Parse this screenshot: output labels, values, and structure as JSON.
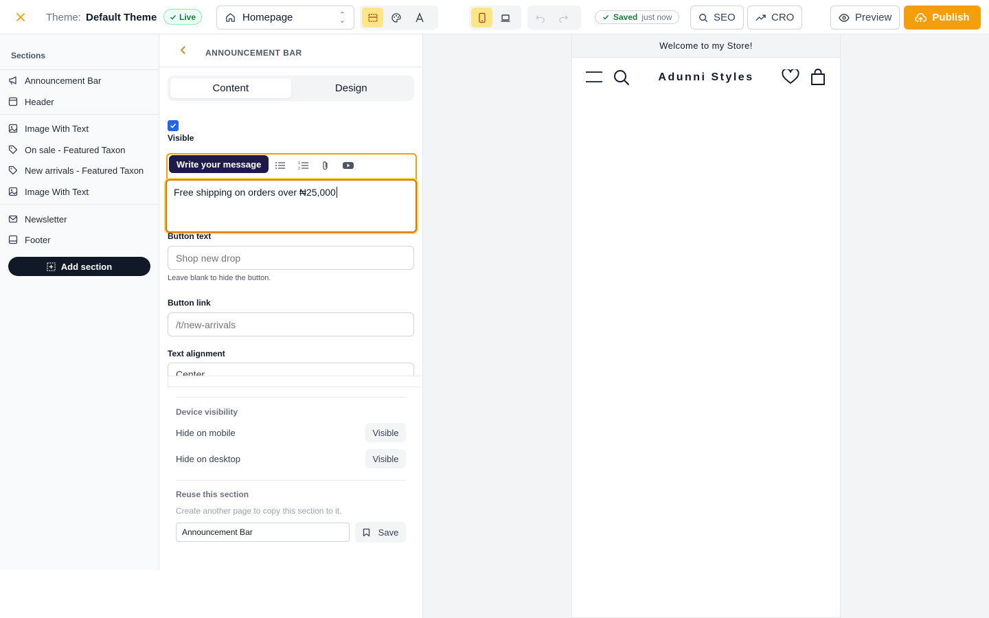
{
  "topbar": {
    "theme_label": "Theme:",
    "theme_name": "Default Theme",
    "live_badge": "Live",
    "page_select": "Homepage",
    "saved_label": "Saved",
    "saved_time": "just now",
    "seo_label": "SEO",
    "cro_label": "CRO",
    "preview_label": "Preview",
    "publish_label": "Publish"
  },
  "sidebar": {
    "heading": "Sections",
    "items": [
      {
        "label": "Announcement Bar",
        "icon": "megaphone-icon"
      },
      {
        "label": "Header",
        "icon": "layout-icon"
      },
      {
        "label": "Image With Text",
        "icon": "image-icon"
      },
      {
        "label": "On sale - Featured Taxon",
        "icon": "tag-icon"
      },
      {
        "label": "New arrivals - Featured Taxon",
        "icon": "tag-icon"
      },
      {
        "label": "Image With Text",
        "icon": "image-icon"
      },
      {
        "label": "Newsletter",
        "icon": "mail-icon"
      },
      {
        "label": "Footer",
        "icon": "footer-icon"
      }
    ],
    "add_section_label": "Add section"
  },
  "panel": {
    "title": "ANNOUNCEMENT BAR",
    "tabs": [
      {
        "label": "Content"
      },
      {
        "label": "Design"
      }
    ],
    "visible_label": "Visible",
    "editor": {
      "tooltip": "Write your message",
      "value": "Free shipping on orders over ₦25,000"
    },
    "button_text": {
      "label": "Button text",
      "placeholder": "Shop new drop",
      "help": "Leave blank to hide the button."
    },
    "button_link": {
      "label": "Button link",
      "placeholder": "/t/new-arrivals"
    },
    "text_alignment": {
      "label": "Text alignment",
      "value": "Center"
    },
    "device_visibility": {
      "heading": "Device visibility",
      "rows": [
        {
          "label": "Hide on mobile",
          "value": "Visible"
        },
        {
          "label": "Hide on desktop",
          "value": "Visible"
        }
      ]
    },
    "reuse": {
      "heading": "Reuse this section",
      "help": "Create another page to copy this section to it.",
      "input_value": "Announcement Bar",
      "save_label": "Save"
    }
  },
  "preview": {
    "announcement": "Welcome to my Store!",
    "store_name": "Adunni Styles"
  },
  "colors": {
    "accent": "#f59e0b",
    "dark": "#111827",
    "checkbox": "#2563eb",
    "live_green": "#15803d"
  }
}
